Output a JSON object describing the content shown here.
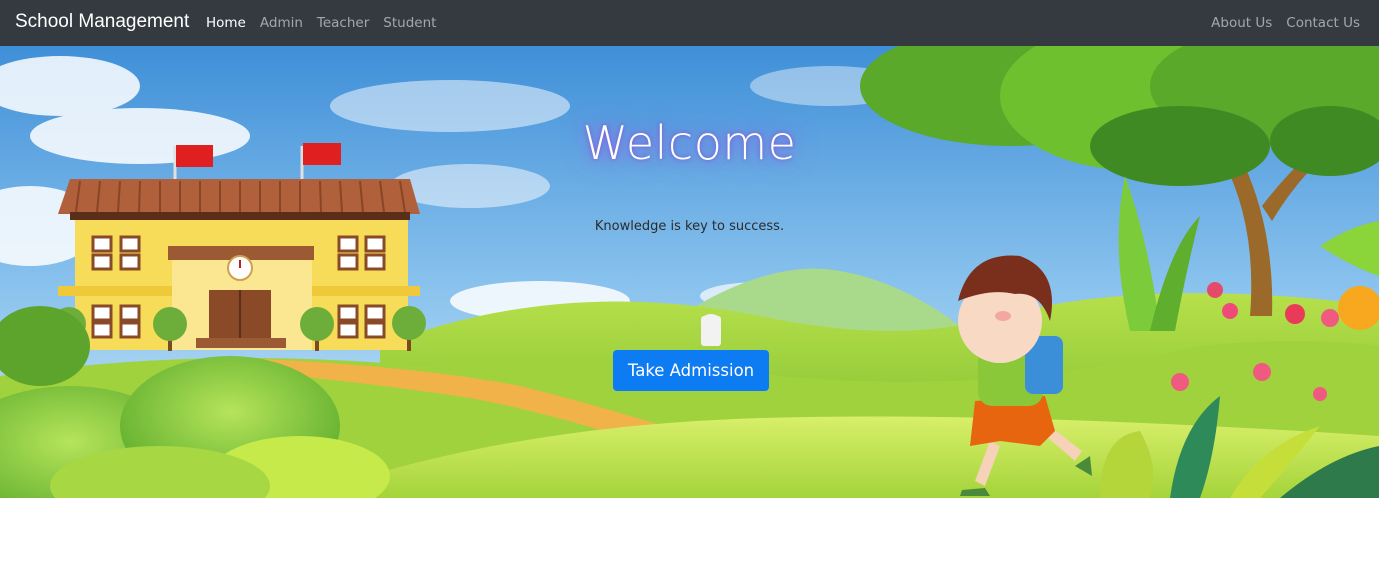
{
  "navbar": {
    "brand": "School Management",
    "left_links": [
      {
        "label": "Home",
        "active": true
      },
      {
        "label": "Admin",
        "active": false
      },
      {
        "label": "Teacher",
        "active": false
      },
      {
        "label": "Student",
        "active": false
      }
    ],
    "right_links": [
      {
        "label": "About Us"
      },
      {
        "label": "Contact Us"
      }
    ]
  },
  "hero": {
    "title": "Welcome",
    "tagline": "Knowledge is key to success.",
    "cta_label": "Take Admission"
  },
  "colors": {
    "navbar_bg": "#343a40",
    "primary_button": "#0d7bf2",
    "active_link": "#ffffff",
    "inactive_link": "rgba(255,255,255,0.55)"
  }
}
